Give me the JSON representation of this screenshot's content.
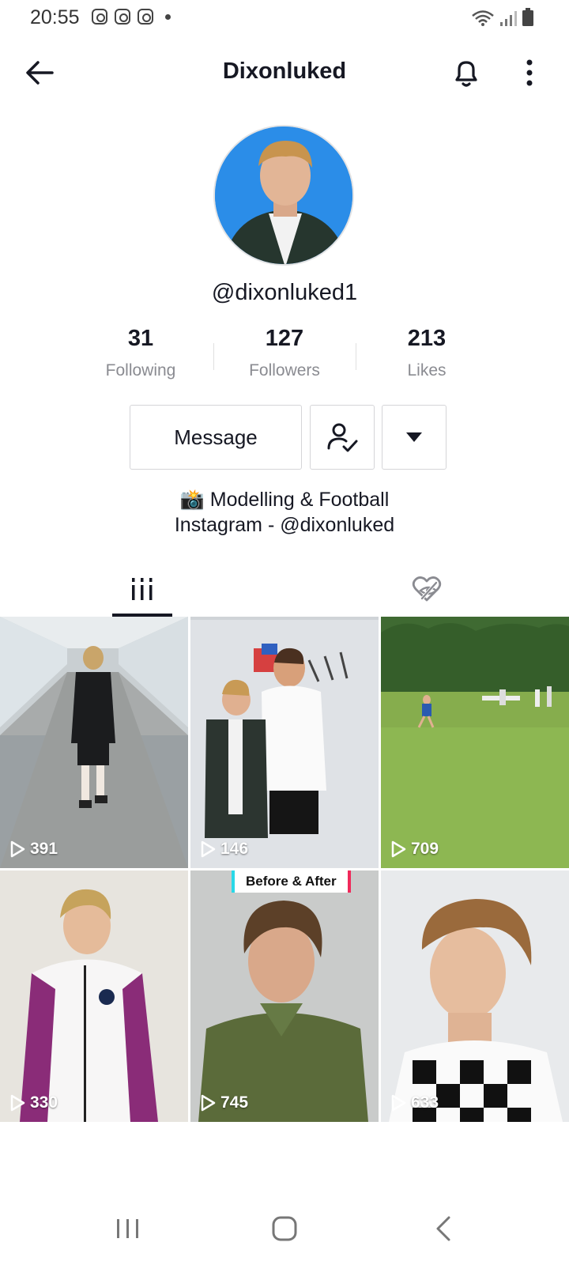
{
  "status_bar": {
    "time": "20:55",
    "left_icons": [
      "instagram-icon",
      "instagram-icon",
      "instagram-icon",
      "notification-dot-icon"
    ],
    "right_icons": [
      "wifi-icon",
      "signal-icon",
      "battery-icon"
    ]
  },
  "header": {
    "title": "Dixonluked",
    "back_icon": "arrow-left-icon",
    "bell_icon": "bell-icon",
    "more_icon": "more-vertical-icon"
  },
  "profile": {
    "avatar": "profile-avatar",
    "username": "@dixonluked1"
  },
  "stats": {
    "following": {
      "value": "31",
      "label": "Following"
    },
    "followers": {
      "value": "127",
      "label": "Followers"
    },
    "likes": {
      "value": "213",
      "label": "Likes"
    }
  },
  "actions": {
    "message_label": "Message",
    "follow_icon": "user-check-icon",
    "dropdown_icon": "caret-down-icon"
  },
  "bio": {
    "line1": "📸 Modelling & Football",
    "line2": "Instagram - @dixonluked"
  },
  "tabs": [
    {
      "name": "videos",
      "icon": "grid-columns-icon",
      "active": true
    },
    {
      "name": "liked",
      "icon": "heart-hidden-icon",
      "active": false
    }
  ],
  "videos": [
    {
      "views": "391"
    },
    {
      "views": "146"
    },
    {
      "views": "709"
    },
    {
      "views": "330"
    },
    {
      "views": "745",
      "overlay_text": "Before & After"
    },
    {
      "views": "633"
    }
  ],
  "nav_bar": {
    "icons": [
      "recents-icon",
      "home-icon",
      "back-icon"
    ]
  },
  "colors": {
    "text": "#161823",
    "muted": "#8a8b91",
    "border": "#d5d5d8"
  }
}
